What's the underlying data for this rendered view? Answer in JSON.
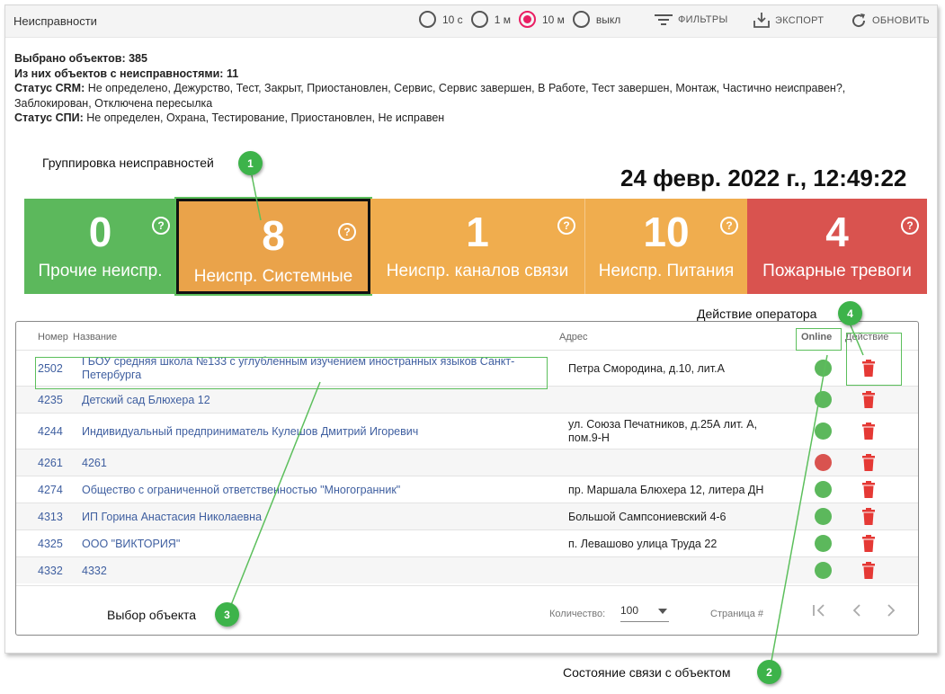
{
  "window": {
    "title": "Неисправности"
  },
  "toolbar": {
    "refresh_options": [
      {
        "label": "10 с",
        "selected": false
      },
      {
        "label": "1 м",
        "selected": false
      },
      {
        "label": "10 м",
        "selected": true
      },
      {
        "label": "выкл",
        "selected": false
      }
    ],
    "filters_label": "ФИЛЬТРЫ",
    "export_label": "ЭКСПОРТ",
    "refresh_label": "ОБНОВИТЬ"
  },
  "info": {
    "selected_label": "Выбрано объектов:",
    "selected_value": "385",
    "faulty_label": "Из них объектов с неисправностями:",
    "faulty_value": "11",
    "crm_label": "Статус CRM:",
    "crm_value": "Не определено, Дежурство, Тест, Закрыт, Приостановлен, Сервис, Сервис завершен, В Работе, Тест завершен, Монтаж, Частично неисправен?, Заблокирован, Отключена пересылка",
    "spi_label": "Статус СПИ:",
    "spi_value": "Не определен, Охрана, Тестирование, Приостановлен, Не исправен"
  },
  "datetime": "24 февр. 2022 г., 12:49:22",
  "tiles": [
    {
      "count": "0",
      "label": "Прочие неиспр.",
      "color": "#5cb85c",
      "help": "?"
    },
    {
      "count": "8",
      "label": "Неиспр. Системные",
      "color": "#f0ad4e",
      "help": "?"
    },
    {
      "count": "1",
      "label": "Неиспр. каналов связи",
      "color": "#f0ad4e",
      "help": "?"
    },
    {
      "count": "10",
      "label": "Неиспр. Питания",
      "color": "#f0ad4e",
      "help": "?"
    },
    {
      "count": "4",
      "label": "Пожарные тревоги",
      "color": "#d9534f",
      "help": "?"
    }
  ],
  "table": {
    "columns": {
      "number": "Номер",
      "name": "Название",
      "address": "Адрес",
      "online": "Online",
      "action": "Действие"
    },
    "rows": [
      {
        "number": "2502",
        "name": "ГБОУ средняя школа №133 с углубленным изучением иностранных языков Санкт-Петербурга",
        "address": "Петра Смородина, д.10, лит.А",
        "online": true
      },
      {
        "number": "4235",
        "name": "Детский сад Блюхера 12",
        "address": "",
        "online": true
      },
      {
        "number": "4244",
        "name": "Индивидуальный предприниматель Кулешов Дмитрий Игоревич",
        "address": "ул. Союза Печатников, д.25А лит. А, пом.9-Н",
        "online": true
      },
      {
        "number": "4261",
        "name": "4261",
        "address": "",
        "online": false
      },
      {
        "number": "4274",
        "name": "Общество с ограниченной ответственностью \"Многогранник\"",
        "address": "пр. Маршала Блюхера 12, литера ДН",
        "online": true
      },
      {
        "number": "4313",
        "name": "ИП Горина Анастасия Николаевна",
        "address": "Большой Сампсониевский 4-6",
        "online": true
      },
      {
        "number": "4325",
        "name": "ООО \"ВИКТОРИЯ\"",
        "address": "п. Левашово улица Труда 22",
        "online": true
      },
      {
        "number": "4332",
        "name": "4332",
        "address": "",
        "online": true
      }
    ],
    "footer": {
      "count_label": "Количество:",
      "count_value": "100",
      "page_label": "Страница #"
    }
  },
  "colors": {
    "online": "#5cb85c",
    "offline": "#d9534f",
    "trash": "#e53935",
    "link": "#3f5fa0",
    "callout": "#3db34a"
  },
  "callouts": [
    {
      "id": "1",
      "text": "Группировка неисправностей"
    },
    {
      "id": "2",
      "text": "Состояние связи с объектом"
    },
    {
      "id": "3",
      "text": "Выбор объекта"
    },
    {
      "id": "4",
      "text": "Действие оператора"
    }
  ]
}
